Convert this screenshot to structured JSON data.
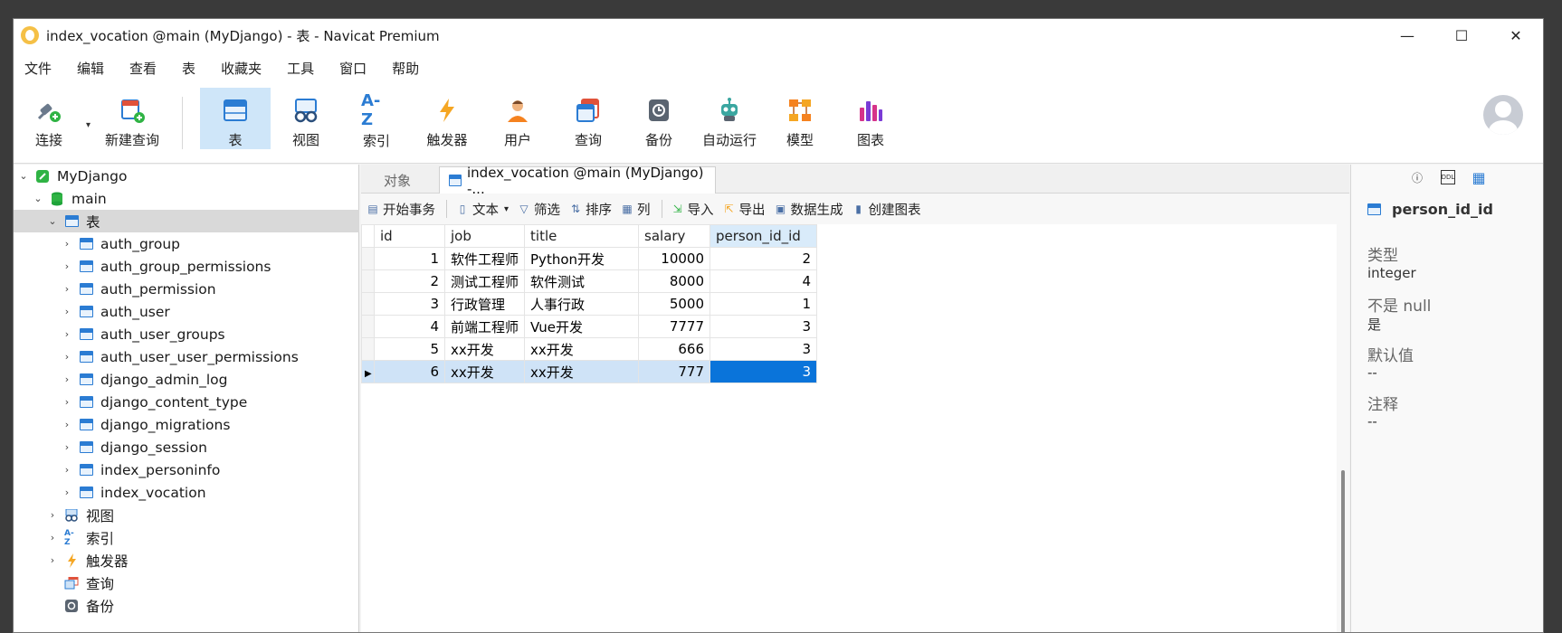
{
  "titlebar": {
    "title": "index_vocation @main (MyDjango) - 表 - Navicat Premium",
    "minimize": "—",
    "maximize": "☐",
    "close": "✕"
  },
  "menu": [
    "文件",
    "编辑",
    "查看",
    "表",
    "收藏夹",
    "工具",
    "窗口",
    "帮助"
  ],
  "toolbar": {
    "connect": "连接",
    "new_query": "新建查询",
    "table": "表",
    "view": "视图",
    "index": "索引",
    "trigger": "触发器",
    "user": "用户",
    "query": "查询",
    "backup": "备份",
    "automation": "自动运行",
    "model": "模型",
    "chart": "图表",
    "index_glyph": "A-Z"
  },
  "tree": {
    "connection": "MyDjango",
    "database": "main",
    "tables_node": "表",
    "tables": [
      "auth_group",
      "auth_group_permissions",
      "auth_permission",
      "auth_user",
      "auth_user_groups",
      "auth_user_user_permissions",
      "django_admin_log",
      "django_content_type",
      "django_migrations",
      "django_session",
      "index_personinfo",
      "index_vocation"
    ],
    "views": "视图",
    "indexes": "索引",
    "triggers": "触发器",
    "queries": "查询",
    "backups": "备份"
  },
  "tabs": {
    "objects": "对象",
    "active": "index_vocation @main (MyDjango) -..."
  },
  "actions": {
    "begin_tx": "开始事务",
    "text": "文本",
    "filter": "筛选",
    "sort": "排序",
    "columns": "列",
    "import": "导入",
    "export": "导出",
    "data_gen": "数据生成",
    "create_chart": "创建图表"
  },
  "grid": {
    "columns": [
      "id",
      "job",
      "title",
      "salary",
      "person_id_id"
    ],
    "rows": [
      [
        "1",
        "软件工程师",
        "Python开发",
        "10000",
        "2"
      ],
      [
        "2",
        "测试工程师",
        "软件测试",
        "8000",
        "4"
      ],
      [
        "3",
        "行政管理",
        "人事行政",
        "5000",
        "1"
      ],
      [
        "4",
        "前端工程师",
        "Vue开发",
        "7777",
        "3"
      ],
      [
        "5",
        "xx开发",
        "xx开发",
        "666",
        "3"
      ],
      [
        "6",
        "xx开发",
        "xx开发",
        "777",
        "3"
      ]
    ]
  },
  "right_panel": {
    "field": "person_id_id",
    "type_label": "类型",
    "type_value": "integer",
    "notnull_label": "不是 null",
    "notnull_value": "是",
    "default_label": "默认值",
    "default_value": "--",
    "comment_label": "注释",
    "comment_value": "--",
    "ddl_icon_text": "DDL"
  },
  "colors": {
    "accent": "#0a74da",
    "selected_row": "#cfe3f7",
    "active_tool": "#cfe6f9"
  }
}
